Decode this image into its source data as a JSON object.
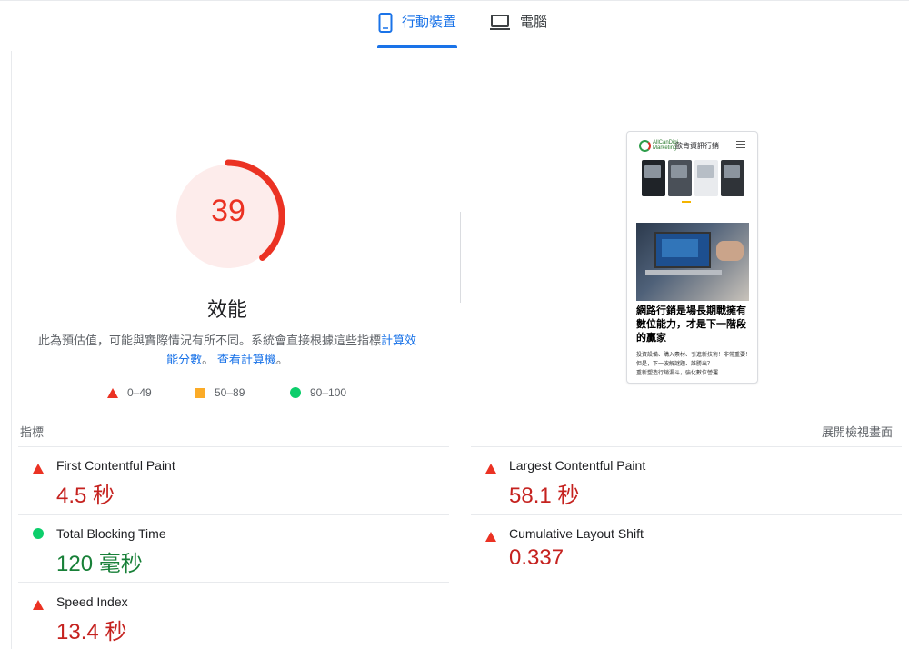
{
  "tabs": [
    {
      "label": "行動裝置",
      "icon": "smartphone-icon",
      "active": true
    },
    {
      "label": "電腦",
      "icon": "laptop-icon",
      "active": false
    }
  ],
  "score": {
    "value": "39",
    "fraction": 0.39,
    "title": "效能",
    "desc_prefix": "此為預估值，可能與實際情況有所不同。系統會直接根據這些指標",
    "link_calc": "計算效能分數",
    "sep": "。",
    "link_calculator": "查看計算機",
    "end": "。"
  },
  "legend": [
    {
      "range": "0–49",
      "shape": "triangle",
      "color": "#eb3223"
    },
    {
      "range": "50–89",
      "shape": "square",
      "color": "#fbab27"
    },
    {
      "range": "90–100",
      "shape": "circle",
      "color": "#0cce6b"
    }
  ],
  "preview": {
    "brand_line1": "AllCanDigi",
    "brand_line2": "Marketing",
    "site_name": "歐肯資訊行銷",
    "headline": "網路行銷是場長期戰擁有數位能力，才是下一階段的贏家",
    "body_lines": [
      "投資設備、購入素材、引進新技術！非常重要！",
      "但是，下一波解謎題、誰勝出？",
      "重新塑造行銷漏斗，強化數位營運"
    ]
  },
  "metrics": {
    "section_label": "指標",
    "expand_label": "展開檢視畫面",
    "items": [
      {
        "label": "First Contentful Paint",
        "value": "4.5 秒",
        "status": "poor"
      },
      {
        "label": "Largest Contentful Paint",
        "value": "58.1 秒",
        "status": "poor"
      },
      {
        "label": "Total Blocking Time",
        "value": "120 毫秒",
        "status": "good"
      },
      {
        "label": "Cumulative Layout Shift",
        "value": "0.337",
        "status": "poor"
      },
      {
        "label": "Speed Index",
        "value": "13.4 秒",
        "status": "poor"
      }
    ]
  },
  "colors": {
    "accent": "#1a73e8",
    "poor": "#eb3223",
    "average": "#fbab27",
    "good": "#0cce6b",
    "poor_text": "#c5221f",
    "good_text": "#188038"
  }
}
